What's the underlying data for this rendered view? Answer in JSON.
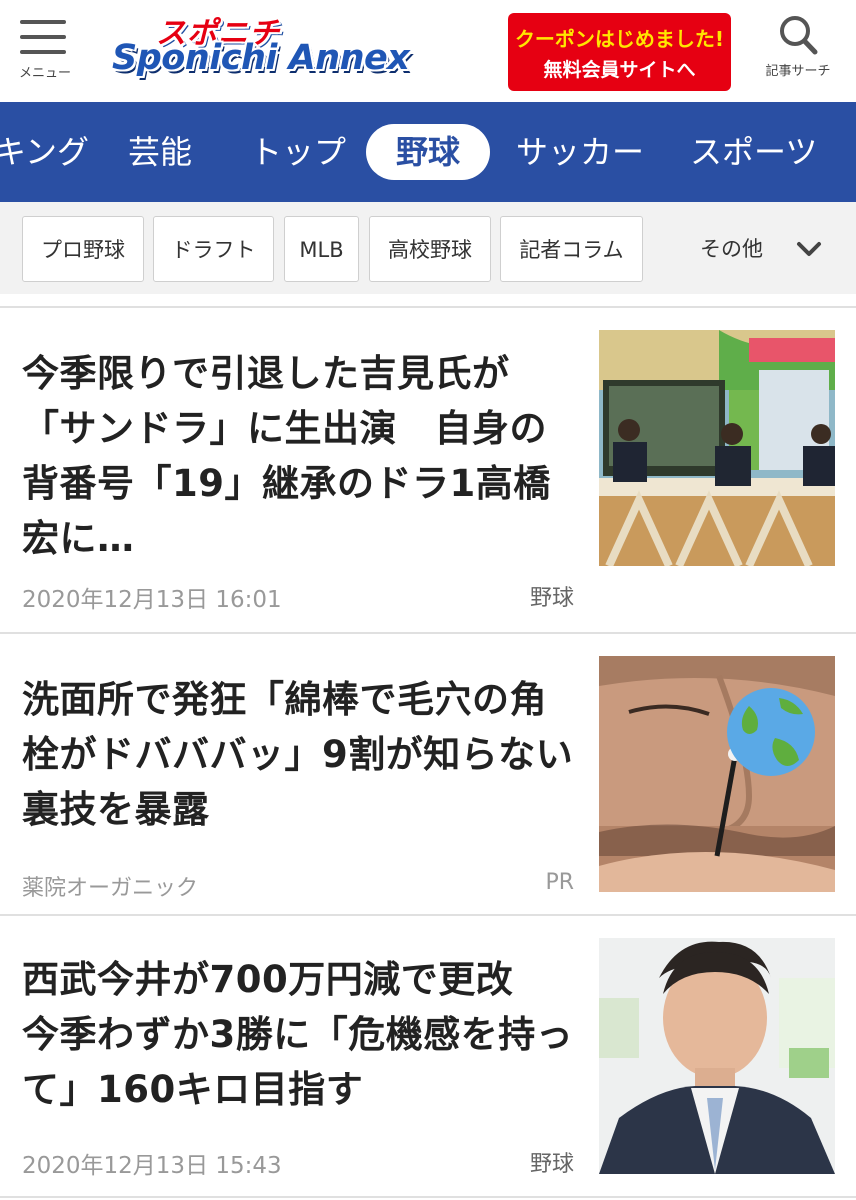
{
  "header": {
    "menu_label": "メニュー",
    "logo_top": "スポニチ",
    "logo_bottom": "Sponichi Annex",
    "coupon_line1": "クーポンはじめました!",
    "coupon_line2": "無料会員サイトへ",
    "search_label": "記事サーチ"
  },
  "categories": [
    "キング",
    "芸能",
    "トップ",
    "野球",
    "サッカー",
    "スポーツ"
  ],
  "active_category": "野球",
  "subnav": {
    "chips": [
      "プロ野球",
      "ドラフト",
      "MLB",
      "高校野球",
      "記者コラム"
    ],
    "more_label": "その他"
  },
  "articles": [
    {
      "title": "今季限りで引退した吉見氏が「サンドラ」に生出演　自身の背番号「19」継承のドラ1高橋宏に…",
      "date": "2020年12月13日 16:01",
      "category": "野球",
      "thumb_icon": "tv-studio-photo"
    },
    {
      "title": "洗面所で発狂「綿棒で毛穴の角栓がドバババッ」9割が知らない裏技を暴露",
      "source": "薬院オーガニック",
      "label": "PR",
      "thumb_icon": "face-cotton-swab-photo",
      "overlay_icon": "globe-icon"
    },
    {
      "title": "西武今井が700万円減で更改　今季わずか3勝に「危機感を持って」160キロ目指す",
      "date": "2020年12月13日 15:43",
      "category": "野球",
      "thumb_icon": "player-press-conference-photo"
    }
  ],
  "colors": {
    "brand_blue": "#2a4fa3",
    "brand_red": "#e60012"
  }
}
